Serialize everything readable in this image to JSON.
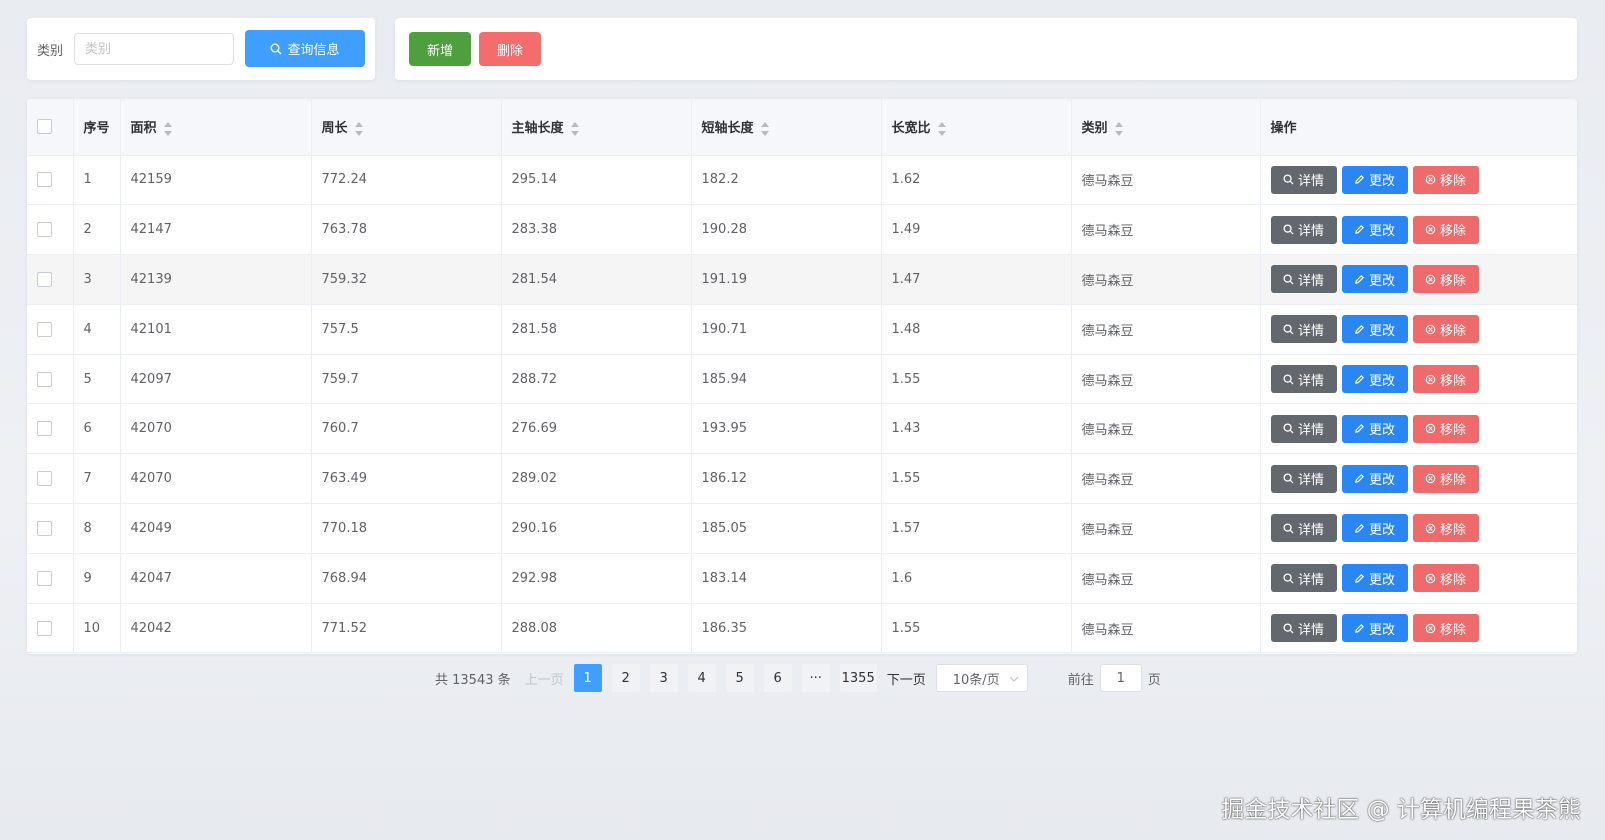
{
  "search": {
    "label": "类别",
    "placeholder": "类别",
    "value": "",
    "query_button": "查询信息"
  },
  "toolbar": {
    "add_button": "新增",
    "delete_button": "删除"
  },
  "table": {
    "headers": {
      "index": "序号",
      "area": "面积",
      "perimeter": "周长",
      "major_axis": "主轴长度",
      "minor_axis": "短轴长度",
      "aspect_ratio": "长宽比",
      "category": "类别",
      "actions": "操作"
    },
    "action_labels": {
      "detail": "详情",
      "edit": "更改",
      "remove": "移除"
    },
    "rows": [
      {
        "index": "1",
        "area": "42159",
        "perimeter": "772.24",
        "major_axis": "295.14",
        "minor_axis": "182.2",
        "aspect_ratio": "1.62",
        "category": "德马森豆"
      },
      {
        "index": "2",
        "area": "42147",
        "perimeter": "763.78",
        "major_axis": "283.38",
        "minor_axis": "190.28",
        "aspect_ratio": "1.49",
        "category": "德马森豆"
      },
      {
        "index": "3",
        "area": "42139",
        "perimeter": "759.32",
        "major_axis": "281.54",
        "minor_axis": "191.19",
        "aspect_ratio": "1.47",
        "category": "德马森豆"
      },
      {
        "index": "4",
        "area": "42101",
        "perimeter": "757.5",
        "major_axis": "281.58",
        "minor_axis": "190.71",
        "aspect_ratio": "1.48",
        "category": "德马森豆"
      },
      {
        "index": "5",
        "area": "42097",
        "perimeter": "759.7",
        "major_axis": "288.72",
        "minor_axis": "185.94",
        "aspect_ratio": "1.55",
        "category": "德马森豆"
      },
      {
        "index": "6",
        "area": "42070",
        "perimeter": "760.7",
        "major_axis": "276.69",
        "minor_axis": "193.95",
        "aspect_ratio": "1.43",
        "category": "德马森豆"
      },
      {
        "index": "7",
        "area": "42070",
        "perimeter": "763.49",
        "major_axis": "289.02",
        "minor_axis": "186.12",
        "aspect_ratio": "1.55",
        "category": "德马森豆"
      },
      {
        "index": "8",
        "area": "42049",
        "perimeter": "770.18",
        "major_axis": "290.16",
        "minor_axis": "185.05",
        "aspect_ratio": "1.57",
        "category": "德马森豆"
      },
      {
        "index": "9",
        "area": "42047",
        "perimeter": "768.94",
        "major_axis": "292.98",
        "minor_axis": "183.14",
        "aspect_ratio": "1.6",
        "category": "德马森豆"
      },
      {
        "index": "10",
        "area": "42042",
        "perimeter": "771.52",
        "major_axis": "288.08",
        "minor_axis": "186.35",
        "aspect_ratio": "1.55",
        "category": "德马森豆"
      }
    ]
  },
  "pagination": {
    "total_text": "共 13543 条",
    "prev": "上一页",
    "pages": [
      "1",
      "2",
      "3",
      "4",
      "5",
      "6",
      "···",
      "1355"
    ],
    "current_page": "1",
    "next": "下一页",
    "page_size": "10条/页",
    "goto_label": "前往",
    "goto_value": "1",
    "page_suffix": "页"
  },
  "watermark": "掘金技术社区 @ 计算机编程果茶熊",
  "colors": {
    "primary": "#409eff",
    "success": "#4e9f3d",
    "danger": "#f56c6c",
    "info": "#63686e"
  }
}
